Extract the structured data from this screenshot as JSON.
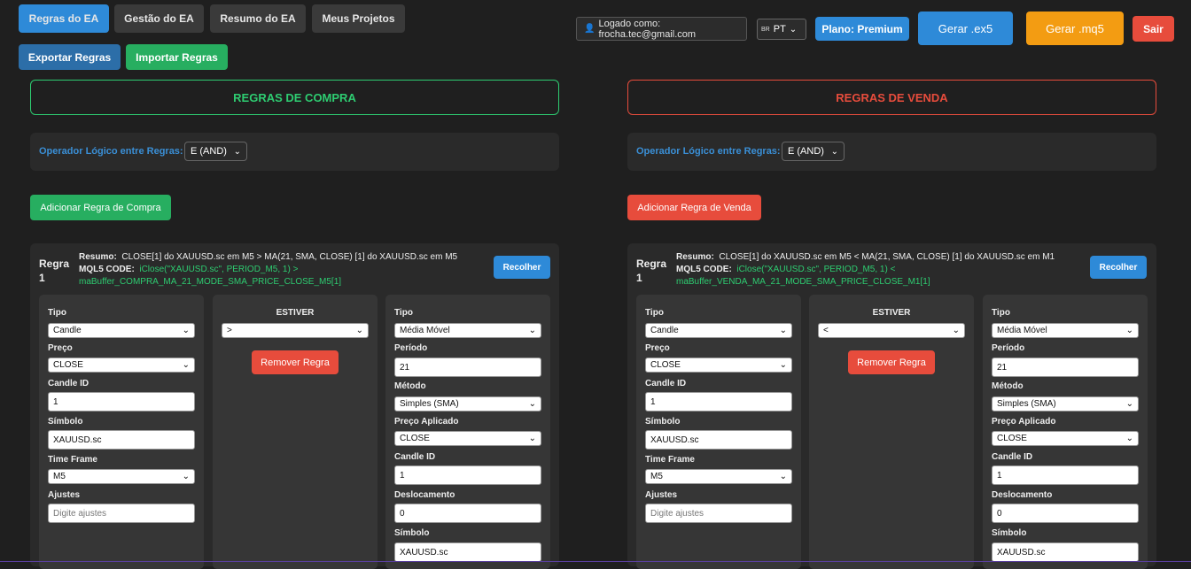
{
  "nav": {
    "tabs": [
      "Regras do EA",
      "Gestão do EA",
      "Resumo do EA",
      "Meus Projetos"
    ],
    "export": "Exportar Regras",
    "import": "Importar Regras"
  },
  "header": {
    "login": "Logado como: frocha.tec@gmail.com",
    "lang_flag": "BR",
    "lang": "PT",
    "plan": "Plano: Premium",
    "gen_ex5": "Gerar .ex5",
    "gen_mq5": "Gerar .mq5",
    "logout": "Sair"
  },
  "buy": {
    "title": "REGRAS DE COMPRA",
    "op_label": "Operador Lógico entre Regras:",
    "op_value": "E (AND)",
    "add_button": "Adicionar Regra de Compra",
    "rule": {
      "title_a": "Regra",
      "title_b": "1",
      "summary_label": "Resumo:",
      "summary": "CLOSE[1] do XAUUSD.sc em M5 > MA(21, SMA, CLOSE) [1] do XAUUSD.sc em M5",
      "code_label": "MQL5 CODE:",
      "code_1": "iClose(\"XAUUSD.sc\", PERIOD_M5, 1) >",
      "code_2": "maBuffer_COMPRA_MA_21_MODE_SMA_PRICE_CLOSE_M5[1]",
      "collapse": "Recolher",
      "left": {
        "tipo_label": "Tipo",
        "tipo": "Candle",
        "preco_label": "Preço",
        "preco": "CLOSE",
        "candle_label": "Candle ID",
        "candle": "1",
        "simbolo_label": "Símbolo",
        "simbolo": "XAUUSD.sc",
        "tf_label": "Time Frame",
        "tf": "M5",
        "ajustes_label": "Ajustes",
        "ajustes_ph": "Digite ajustes"
      },
      "middle": {
        "label": "ESTIVER",
        "op": ">",
        "remove": "Remover Regra"
      },
      "right": {
        "tipo_label": "Tipo",
        "tipo": "Média Móvel",
        "periodo_label": "Período",
        "periodo": "21",
        "metodo_label": "Método",
        "metodo": "Simples (SMA)",
        "preco_label": "Preço Aplicado",
        "preco": "CLOSE",
        "candle_label": "Candle ID",
        "candle": "1",
        "desloc_label": "Deslocamento",
        "desloc": "0",
        "simbolo_label": "Símbolo",
        "simbolo": "XAUUSD.sc"
      }
    }
  },
  "sell": {
    "title": "REGRAS DE VENDA",
    "op_label": "Operador Lógico entre Regras:",
    "op_value": "E (AND)",
    "add_button": "Adicionar Regra de Venda",
    "rule": {
      "title_a": "Regra",
      "title_b": "1",
      "summary_label": "Resumo:",
      "summary": "CLOSE[1] do XAUUSD.sc em M5 < MA(21, SMA, CLOSE) [1] do XAUUSD.sc em M1",
      "code_label": "MQL5 CODE:",
      "code_1": "iClose(\"XAUUSD.sc\", PERIOD_M5, 1) <",
      "code_2": "maBuffer_VENDA_MA_21_MODE_SMA_PRICE_CLOSE_M1[1]",
      "collapse": "Recolher",
      "left": {
        "tipo_label": "Tipo",
        "tipo": "Candle",
        "preco_label": "Preço",
        "preco": "CLOSE",
        "candle_label": "Candle ID",
        "candle": "1",
        "simbolo_label": "Símbolo",
        "simbolo": "XAUUSD.sc",
        "tf_label": "Time Frame",
        "tf": "M5",
        "ajustes_label": "Ajustes",
        "ajustes_ph": "Digite ajustes"
      },
      "middle": {
        "label": "ESTIVER",
        "op": "<",
        "remove": "Remover Regra"
      },
      "right": {
        "tipo_label": "Tipo",
        "tipo": "Média Móvel",
        "periodo_label": "Período",
        "periodo": "21",
        "metodo_label": "Método",
        "metodo": "Simples (SMA)",
        "preco_label": "Preço Aplicado",
        "preco": "CLOSE",
        "candle_label": "Candle ID",
        "candle": "1",
        "desloc_label": "Deslocamento",
        "desloc": "0",
        "simbolo_label": "Símbolo",
        "simbolo": "XAUUSD.sc"
      }
    }
  },
  "colors": {
    "background": "#1f1f1f",
    "buy_green": "#2ecc71",
    "sell_red": "#e74c3c",
    "accent_blue": "#2e8ad8",
    "orange": "#f39c12"
  }
}
